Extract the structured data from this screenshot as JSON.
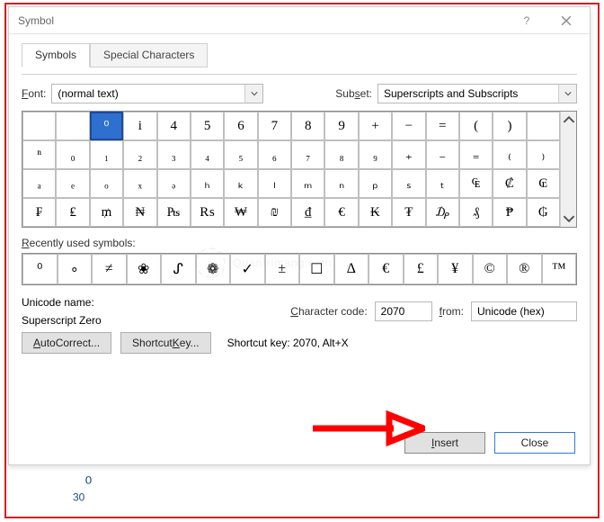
{
  "titlebar": {
    "title": "Symbol"
  },
  "tabs": {
    "symbols": "Symbols",
    "special": "Special Characters"
  },
  "font": {
    "label": "Font:",
    "value": "(normal text)"
  },
  "subset": {
    "label": "Subset:",
    "value": "Superscripts and Subscripts"
  },
  "grid": {
    "rows": [
      [
        "",
        "",
        "⁰",
        "i",
        "4",
        "5",
        "6",
        "7",
        "8",
        "9",
        "+",
        "−",
        "=",
        "(",
        ")",
        ""
      ],
      [
        "ⁿ",
        "₀",
        "₁",
        "₂",
        "₃",
        "₄",
        "₅",
        "₆",
        "₇",
        "₈",
        "₉",
        "₊",
        "₋",
        "₌",
        "₍",
        "₎"
      ],
      [
        "ₐ",
        "ₑ",
        "ₒ",
        "ₓ",
        "ₔ",
        "ₕ",
        "ₖ",
        "ₗ",
        "ₘ",
        "ₙ",
        "ₚ",
        "ₛ",
        "ₜ",
        "₠",
        "₡",
        "₢"
      ],
      [
        "₣",
        "₤",
        "₥",
        "₦",
        "₧",
        "₨",
        "₩",
        "₪",
        "₫",
        "€",
        "₭",
        "₮",
        "₯",
        "₰",
        "₱",
        "₲"
      ]
    ],
    "selected": [
      0,
      2
    ]
  },
  "recent": {
    "label": "Recently used symbols:",
    "items": [
      "⁰",
      "∘",
      "≠",
      "❀",
      "ᔑ",
      "❁",
      "✓",
      "±",
      "☐",
      "∆",
      "€",
      "£",
      "¥",
      "©",
      "®",
      "™"
    ]
  },
  "unicode": {
    "label": "Unicode name:",
    "value": "Superscript Zero"
  },
  "charcode": {
    "label": "Character code:",
    "value": "2070"
  },
  "from": {
    "label": "from:",
    "value": "Unicode (hex)"
  },
  "buttons": {
    "autocorrect": "AutoCorrect...",
    "shortcutkey": "Shortcut Key...",
    "shortcuttext": "Shortcut key: 2070, Alt+X",
    "insert": "Insert",
    "close": "Close"
  },
  "underlines": {
    "font_u": "F",
    "font_rest": "ont:",
    "subset_u": "S",
    "subset_pre": "Sub",
    "subset_rest": "et:",
    "recent_u": "R",
    "recent_rest": "ecently used symbols:",
    "char_u": "C",
    "char_rest": "haracter code:",
    "from_u": "f",
    "from_rest": "rom:",
    "auto_u": "A",
    "auto_rest": "utoCorrect...",
    "sk_pre": "Shortcut ",
    "sk_u": "K",
    "sk_rest": "ey...",
    "ins_u": "I",
    "ins_rest": "nsert"
  },
  "document": {
    "text": "30",
    "sup": "⁰"
  },
  "watermark": "Quantrimang.com"
}
